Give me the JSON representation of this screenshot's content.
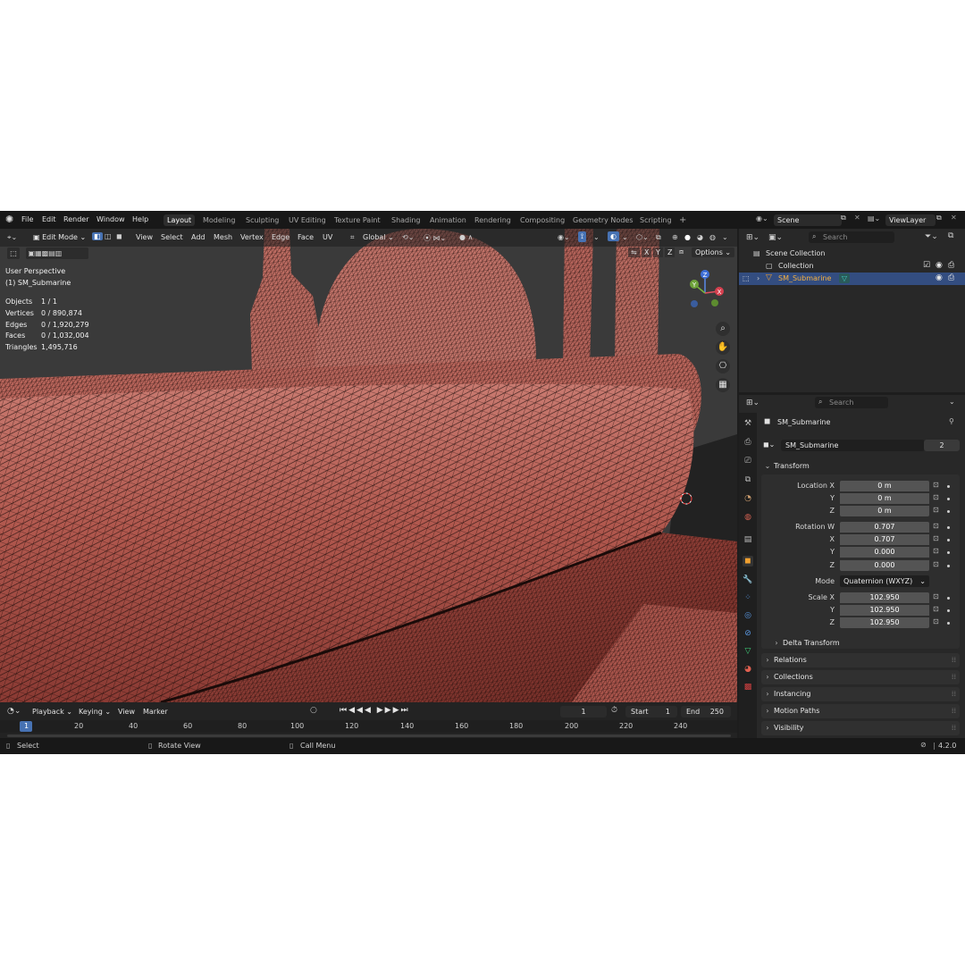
{
  "menu": {
    "file": "File",
    "edit": "Edit",
    "render": "Render",
    "window": "Window",
    "help": "Help"
  },
  "workspaces": [
    "Layout",
    "Modeling",
    "Sculpting",
    "UV Editing",
    "Texture Paint",
    "Shading",
    "Animation",
    "Rendering",
    "Compositing",
    "Geometry Nodes",
    "Scripting"
  ],
  "workspace_add": "+",
  "scene": {
    "name": "Scene",
    "view_layer": "ViewLayer"
  },
  "viewport": {
    "mode": "Edit Mode",
    "menus": {
      "view": "View",
      "select": "Select",
      "add": "Add",
      "mesh": "Mesh",
      "vertex": "Vertex",
      "edge": "Edge",
      "face": "Face",
      "uv": "UV"
    },
    "orientation": "Global",
    "axes": {
      "x": "X",
      "y": "Y",
      "z": "Z"
    },
    "options": "Options",
    "perspective": "User Perspective",
    "object_line": "(1) SM_Submarine",
    "stats": [
      {
        "label": "Objects",
        "value": "1 / 1"
      },
      {
        "label": "Vertices",
        "value": "0 / 890,874"
      },
      {
        "label": "Edges",
        "value": "0 / 1,920,279"
      },
      {
        "label": "Faces",
        "value": "0 / 1,032,004"
      },
      {
        "label": "Triangles",
        "value": "1,495,716"
      }
    ],
    "gizmo": {
      "x": "X",
      "y": "Y",
      "z": "Z"
    },
    "mesh_color": "#b86a60",
    "wire_color": "#1a0d0b"
  },
  "timeline": {
    "playback": "Playback",
    "keying": "Keying",
    "view": "View",
    "marker": "Marker",
    "current_frame": "1",
    "start_label": "Start",
    "start": "1",
    "end_label": "End",
    "end": "250",
    "ticks": [
      "1",
      "20",
      "40",
      "60",
      "80",
      "100",
      "120",
      "140",
      "160",
      "180",
      "200",
      "220",
      "240"
    ]
  },
  "statusbar": {
    "select": "Select",
    "rotate": "Rotate View",
    "call_menu": "Call Menu",
    "version": "4.2.0"
  },
  "outliner": {
    "search_placeholder": "Search",
    "scene_collection": "Scene Collection",
    "collection": "Collection",
    "object": "SM_Submarine"
  },
  "properties": {
    "search_placeholder": "Search",
    "object_name": "SM_Submarine",
    "datablock_name": "SM_Submarine",
    "datablock_users": "2",
    "transform_title": "Transform",
    "location": {
      "label_x": "Location X",
      "label_y": "Y",
      "label_z": "Z",
      "x": "0 m",
      "y": "0 m",
      "z": "0 m"
    },
    "rotation": {
      "label_w": "Rotation W",
      "label_x": "X",
      "label_y": "Y",
      "label_z": "Z",
      "w": "0.707",
      "x": "0.707",
      "y": "0.000",
      "z": "0.000"
    },
    "mode_label": "Mode",
    "mode_value": "Quaternion (WXYZ)",
    "scale": {
      "label_x": "Scale X",
      "label_y": "Y",
      "label_z": "Z",
      "x": "102.950",
      "y": "102.950",
      "z": "102.950"
    },
    "delta_transform": "Delta Transform",
    "panels": [
      "Relations",
      "Collections",
      "Instancing",
      "Motion Paths",
      "Visibility"
    ]
  },
  "colors": {
    "accent": "#4772b3",
    "selected_row": "#334d80",
    "object_orange": "#f0a030"
  }
}
